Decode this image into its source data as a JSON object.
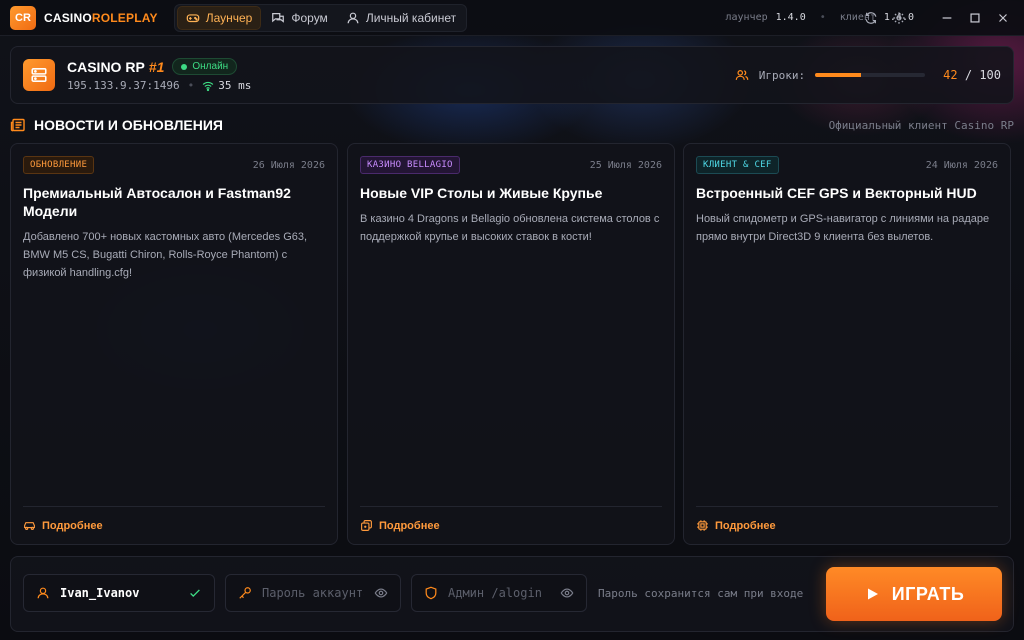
{
  "app": {
    "logo_text": "CR",
    "brand_part1": "CASINO",
    "brand_part2": "ROLEPLAY"
  },
  "nav": [
    {
      "label": "Лаунчер",
      "icon": "gamepad-icon",
      "active": true
    },
    {
      "label": "Форум",
      "icon": "chat-icon",
      "active": false
    },
    {
      "label": "Личный кабинет",
      "icon": "user-icon",
      "active": false
    }
  ],
  "versions": {
    "launcher_label": "лаунчер",
    "launcher_version": "1.4.0",
    "client_label": "клиент",
    "client_version": "1.4.0"
  },
  "server": {
    "name": "CASINO RP",
    "number": "#1",
    "status": "Онлайн",
    "address": "195.133.9.37:1496",
    "ping": "35 ms",
    "players_label": "Игроки:",
    "players_current": "42",
    "players_sep": "/",
    "players_max": "100",
    "players_fraction": 0.42
  },
  "news": {
    "title": "НОВОСТИ И ОБНОВЛЕНИЯ",
    "subtitle": "Официальный клиент Casino RP",
    "items": [
      {
        "tag": "ОБНОВЛЕНИЕ",
        "tag_color": "orange",
        "date": "26 Июля 2026",
        "title": "Премиальный Автосалон и Fastman92 Модели",
        "text": "Добавлено 700+ новых кастомных авто (Mercedes G63, BMW M5 CS, Bugatti Chiron, Rolls-Royce Phantom) с физикой handling.cfg!",
        "more": "Подробнее",
        "icon": "car-icon"
      },
      {
        "tag": "КАЗИНО BELLAGIO",
        "tag_color": "purple",
        "date": "25 Июля 2026",
        "title": "Новые VIP Столы и Живые Крупье",
        "text": "В казино 4 Dragons и Bellagio обновлена система столов с поддержкой крупье и высоких ставок в кости!",
        "more": "Подробнее",
        "icon": "dice-icon"
      },
      {
        "tag": "КЛИЕНТ & CEF",
        "tag_color": "cyan",
        "date": "24 Июля 2026",
        "title": "Встроенный CEF GPS и Векторный HUD",
        "text": "Новый спидометр и GPS-навигатор с линиями на радаре прямо внутри Direct3D 9 клиента без вылетов.",
        "more": "Подробнее",
        "icon": "chip-icon"
      }
    ]
  },
  "login": {
    "username": "Ivan_Ivanov",
    "password_placeholder": "Пароль аккаунта",
    "admin_placeholder": "Админ /alogin",
    "hint": "Пароль сохранится сам при входе",
    "play_label": "ИГРАТЬ"
  },
  "colors": {
    "accent": "#ff8a1c",
    "online": "#3ddc84",
    "background": "#0c0d12"
  }
}
